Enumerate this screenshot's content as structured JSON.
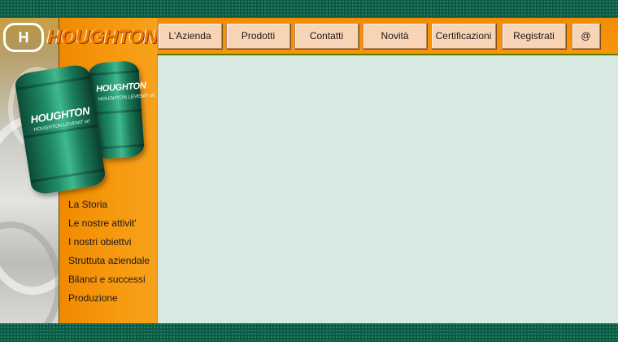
{
  "brand": {
    "logo_text": "HOUGHTON",
    "logo_mark": "H"
  },
  "barrels": {
    "large_label": "HOUGHTON",
    "large_sub": "HOUGHTON LEVENIT srl",
    "small_label": "HOUGHTON",
    "small_sub": "HOUGHTON LEVENIT srl"
  },
  "topnav": [
    {
      "label": "L'Azienda"
    },
    {
      "label": "Prodotti"
    },
    {
      "label": "Contatti"
    },
    {
      "label": "Novità"
    },
    {
      "label": "Certificazioni"
    },
    {
      "label": "Registrati"
    },
    {
      "label": "@"
    }
  ],
  "leftnav": [
    {
      "label": "La Storia"
    },
    {
      "label": "Le nostre attivit'"
    },
    {
      "label": "I nostri obiettvi"
    },
    {
      "label": "Struttuta aziendale"
    },
    {
      "label": "Bilanci e successi"
    },
    {
      "label": "Produzione"
    }
  ],
  "colors": {
    "frame_green": "#0b5a45",
    "orange": "#f58c00",
    "tab_bg": "#f8d4b6",
    "content_bg": "#d8e9e2",
    "barrel_green": "#1f8a66"
  }
}
